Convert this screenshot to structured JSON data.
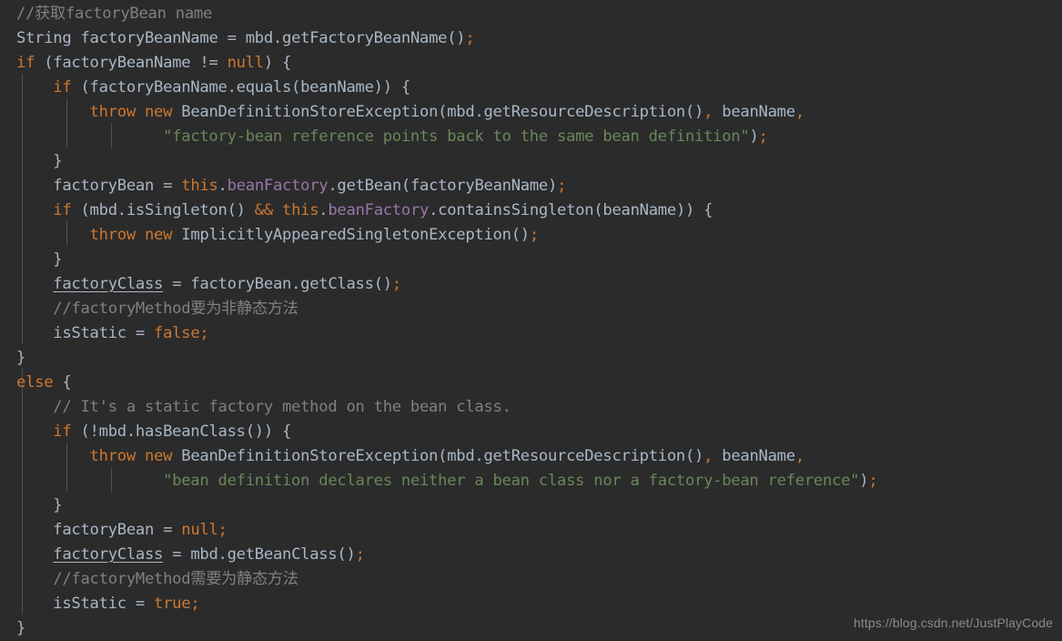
{
  "editor": {
    "theme_name": "darcula",
    "background_color": "#2b2b2b",
    "default_text_color": "#a9b7c6",
    "keyword_color": "#cc7832",
    "string_color": "#6a8759",
    "comment_color": "#808080",
    "field_color": "#9876aa",
    "indent_guide_color": "#4e5254",
    "language": "java"
  },
  "watermark": {
    "text": "https://blog.csdn.net/JustPlayCode"
  },
  "code": {
    "lines": [
      {
        "n": 1,
        "indent": 0,
        "text": "//获取factoryBean name"
      },
      {
        "n": 2,
        "indent": 0,
        "text": "String factoryBeanName = mbd.getFactoryBeanName();"
      },
      {
        "n": 3,
        "indent": 0,
        "text": "if (factoryBeanName != null) {"
      },
      {
        "n": 4,
        "indent": 1,
        "text": "if (factoryBeanName.equals(beanName)) {"
      },
      {
        "n": 5,
        "indent": 2,
        "text": "throw new BeanDefinitionStoreException(mbd.getResourceDescription(), beanName,"
      },
      {
        "n": 6,
        "indent": 4,
        "text": "\"factory-bean reference points back to the same bean definition\");"
      },
      {
        "n": 7,
        "indent": 1,
        "text": "}"
      },
      {
        "n": 8,
        "indent": 1,
        "text": "factoryBean = this.beanFactory.getBean(factoryBeanName);"
      },
      {
        "n": 9,
        "indent": 1,
        "text": "if (mbd.isSingleton() && this.beanFactory.containsSingleton(beanName)) {"
      },
      {
        "n": 10,
        "indent": 2,
        "text": "throw new ImplicitlyAppearedSingletonException();"
      },
      {
        "n": 11,
        "indent": 1,
        "text": "}"
      },
      {
        "n": 12,
        "indent": 1,
        "text": "factoryClass = factoryBean.getClass();"
      },
      {
        "n": 13,
        "indent": 1,
        "text": "//factoryMethod要为非静态方法"
      },
      {
        "n": 14,
        "indent": 1,
        "text": "isStatic = false;"
      },
      {
        "n": 15,
        "indent": 0,
        "text": "}"
      },
      {
        "n": 16,
        "indent": 0,
        "text": "else {"
      },
      {
        "n": 17,
        "indent": 1,
        "text": "// It's a static factory method on the bean class."
      },
      {
        "n": 18,
        "indent": 1,
        "text": "if (!mbd.hasBeanClass()) {"
      },
      {
        "n": 19,
        "indent": 2,
        "text": "throw new BeanDefinitionStoreException(mbd.getResourceDescription(), beanName,"
      },
      {
        "n": 20,
        "indent": 4,
        "text": "\"bean definition declares neither a bean class nor a factory-bean reference\");"
      },
      {
        "n": 21,
        "indent": 1,
        "text": "}"
      },
      {
        "n": 22,
        "indent": 1,
        "text": "factoryBean = null;"
      },
      {
        "n": 23,
        "indent": 1,
        "text": "factoryClass = mbd.getBeanClass();"
      },
      {
        "n": 24,
        "indent": 1,
        "text": "//factoryMethod需要为静态方法"
      },
      {
        "n": 25,
        "indent": 1,
        "text": "isStatic = true;"
      },
      {
        "n": 26,
        "indent": 0,
        "text": "}"
      }
    ],
    "keywords": [
      "if",
      "else",
      "throw",
      "new",
      "null",
      "this",
      "true",
      "false"
    ],
    "underlined_identifiers": [
      "factoryClass"
    ],
    "field_identifiers": [
      "beanFactory"
    ],
    "comments": [
      "//获取factoryBean name",
      "//factoryMethod要为非静态方法",
      "// It's a static factory method on the bean class.",
      "//factoryMethod需要为静态方法"
    ],
    "strings": [
      "\"factory-bean reference points back to the same bean definition\"",
      "\"bean definition declares neither a bean class nor a factory-bean reference\""
    ]
  }
}
